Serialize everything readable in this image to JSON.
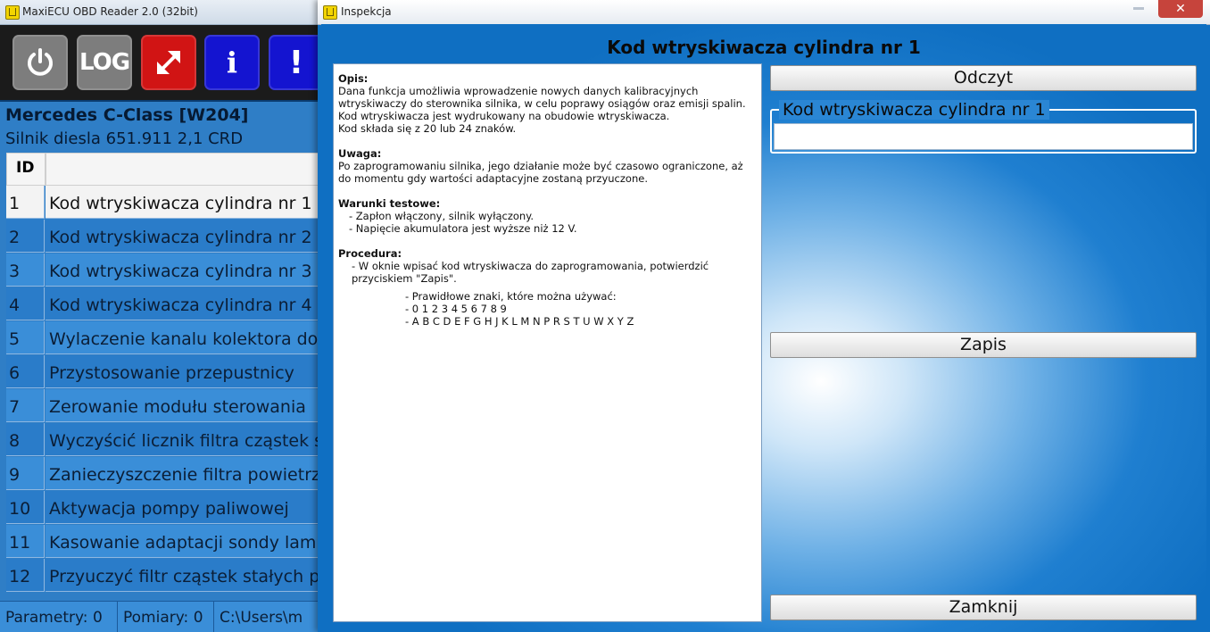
{
  "main_window": {
    "title": "MaxiECU OBD Reader 2.0 (32bit)",
    "toolbar": {
      "power_icon": "power-icon",
      "log_label": "LOG",
      "expand_icon": "expand-arrows-icon",
      "info_label": "i",
      "alert_label": "!"
    },
    "vehicle": {
      "model": "Mercedes C-Class [W204]",
      "engine": "Silnik diesla 651.911 2,1 CRD"
    },
    "table": {
      "headers": [
        "ID",
        ""
      ],
      "rows": [
        {
          "id": "1",
          "name": "Kod wtryskiwacza cylindra nr 1"
        },
        {
          "id": "2",
          "name": "Kod wtryskiwacza cylindra nr 2"
        },
        {
          "id": "3",
          "name": "Kod wtryskiwacza cylindra nr 3"
        },
        {
          "id": "4",
          "name": "Kod wtryskiwacza cylindra nr 4"
        },
        {
          "id": "5",
          "name": "Wylaczenie kanalu kolektora dolo"
        },
        {
          "id": "6",
          "name": "Przystosowanie przepustnicy"
        },
        {
          "id": "7",
          "name": "Zerowanie modułu sterowania"
        },
        {
          "id": "8",
          "name": "Wyczyścić licznik filtra cząstek st"
        },
        {
          "id": "9",
          "name": "Zanieczyszczenie filtra powietrza"
        },
        {
          "id": "10",
          "name": "Aktywacja pompy paliwowej"
        },
        {
          "id": "11",
          "name": "Kasowanie adaptacji sondy lamb"
        },
        {
          "id": "12",
          "name": "Przyuczyć filtr cząstek stałych po"
        }
      ]
    },
    "status": {
      "params": "Parametry: 0",
      "measurements": "Pomiary: 0",
      "path": "C:\\Users\\m"
    }
  },
  "dialog": {
    "title": "Inspekcja",
    "close_label": "✕",
    "heading": "Kod wtryskiwacza cylindra nr 1",
    "description": {
      "opis_title": "Opis:",
      "opis_line1": "Dana funkcja umożliwia wprowadzenie nowych danych kalibracyjnych wtryskiwaczy do sterownika silnika, w celu poprawy osiągów oraz emisji spalin.",
      "opis_line2": "Kod wtryskiwacza jest wydrukowany na obudowie wtryskiwacza.",
      "opis_line3": "Kod składa się z 20 lub 24 znaków.",
      "uwaga_title": "Uwaga:",
      "uwaga_text": "Po zaprogramowaniu silnika, jego działanie może być czasowo ograniczone, aż do momentu gdy wartości adaptacyjne zostaną przyuczone.",
      "warunki_title": "Warunki testowe:",
      "warunki_1": "- Zapłon włączony, silnik wyłączony.",
      "warunki_2": "- Napięcie akumulatora jest wyższe niż 12 V.",
      "procedura_title": "Procedura:",
      "procedura_1": "-  W oknie wpisać kod wtryskiwacza do zaprogramowania, potwierdzić przyciskiem \"Zapis\".",
      "procedura_2": "-  Prawidłowe znaki, które można używać:",
      "procedura_3": "-  0 1 2 3 4 5 6 7 8 9",
      "procedura_4": "- A B C D E F G H J K L M N P R S T U W X Y Z"
    },
    "read_button": "Odczyt",
    "code_group_label": "Kod wtryskiwacza cylindra nr 1",
    "code_value": "",
    "save_button": "Zapis",
    "close_button": "Zamknij"
  }
}
